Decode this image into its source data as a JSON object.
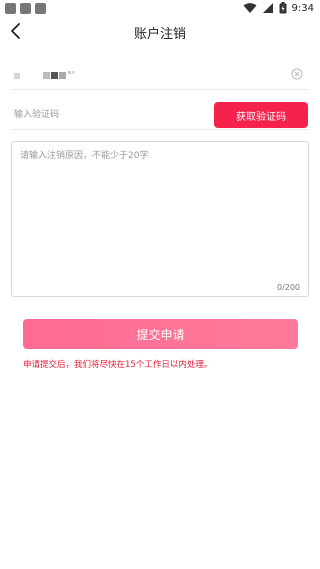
{
  "status_bar": {
    "time": "9:34"
  },
  "header": {
    "title": "账户注销"
  },
  "account": {
    "masked_text": "■ ■"
  },
  "code": {
    "placeholder": "输入验证码",
    "button_label": "获取验证码"
  },
  "reason": {
    "placeholder": "请输入注销原因，不能少于20字",
    "counter": "0/200"
  },
  "submit": {
    "label": "提交申请"
  },
  "notice": {
    "text": "申请提交后，我们将尽快在15个工作日以内处理。"
  },
  "colors": {
    "accent": "#f5234b",
    "submit_gradient_start": "#ff6b93",
    "notice": "#e61e3c"
  }
}
